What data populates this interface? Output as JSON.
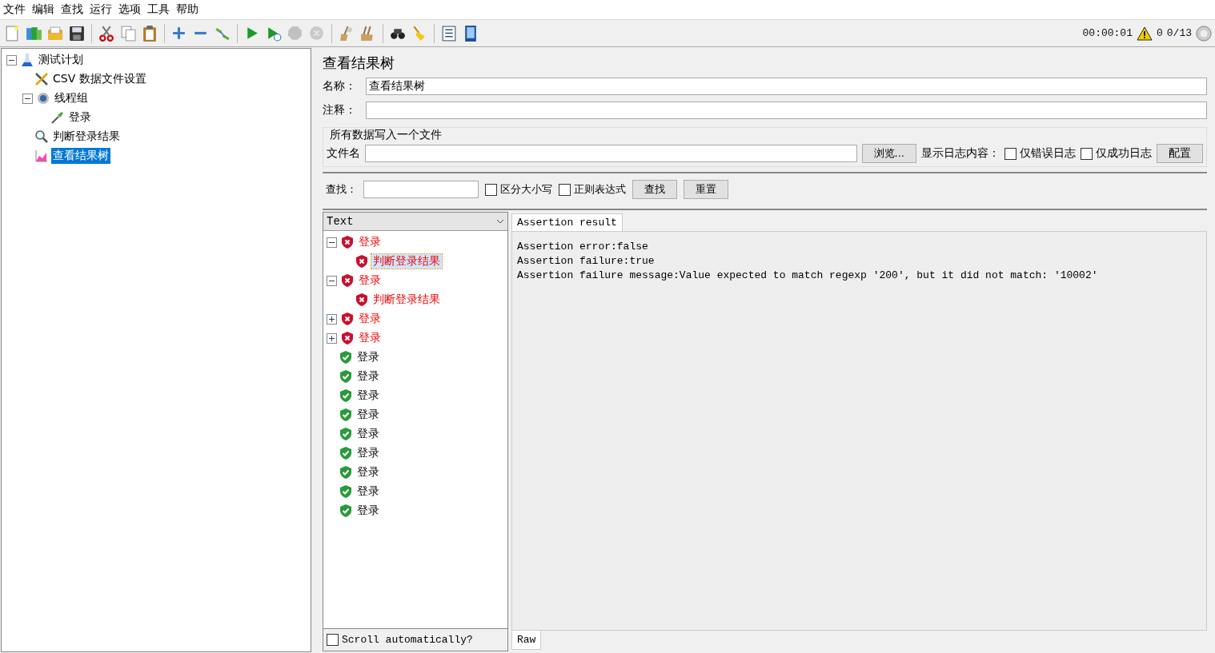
{
  "menu": [
    "文件",
    "编辑",
    "查找",
    "运行",
    "选项",
    "工具",
    "帮助"
  ],
  "toolbar": [
    [
      {
        "disabled": false
      },
      {
        "disabled": false
      },
      {
        "disabled": false
      },
      {
        "disabled": false
      }
    ],
    [
      {
        "disabled": false
      },
      {
        "disabled": false
      },
      {
        "disabled": false
      }
    ],
    [
      {
        "disabled": false
      },
      {
        "disabled": false
      },
      {
        "disabled": false
      }
    ],
    [
      {
        "disabled": false
      },
      {
        "disabled": false
      },
      {
        "disabled": true
      },
      {
        "disabled": true
      }
    ],
    [
      {
        "disabled": false
      },
      {
        "disabled": false
      }
    ],
    [
      {
        "disabled": false
      },
      {
        "disabled": false
      }
    ],
    [
      {
        "disabled": false
      },
      {
        "disabled": false
      }
    ]
  ],
  "status": {
    "timer": "00:00:01",
    "warnings": "0",
    "threads": "0/13"
  },
  "tree": [
    {
      "label": "测试计划",
      "kind": "plan",
      "expanded": true,
      "selected": false,
      "children": [
        {
          "label": "CSV 数据文件设置",
          "kind": "config",
          "selected": false
        },
        {
          "label": "线程组",
          "kind": "threads",
          "expanded": true,
          "selected": false,
          "children": [
            {
              "label": "登录",
              "kind": "sampler",
              "selected": false
            }
          ]
        },
        {
          "label": "判断登录结果",
          "kind": "assertion",
          "selected": false
        },
        {
          "label": "查看结果树",
          "kind": "listener",
          "selected": true
        }
      ]
    }
  ],
  "panel": {
    "title": "查看结果树",
    "name_label": "名称：",
    "name_value": "查看结果树",
    "comment_label": "注释：",
    "file_group": "所有数据写入一个文件",
    "file_label": "文件名",
    "browse": "浏览...",
    "log_label": "显示日志内容：",
    "checks": [
      {
        "label": "仅错误日志",
        "checked": false
      },
      {
        "label": "仅成功日志",
        "checked": false
      }
    ],
    "config": "配置",
    "search_label": "查找：",
    "search_checks": [
      {
        "label": "区分大小写",
        "checked": false
      },
      {
        "label": "正则表达式",
        "checked": false
      }
    ],
    "find": "查找",
    "reset": "重置"
  },
  "results": {
    "renderer": "Text",
    "items": [
      {
        "label": "登录",
        "passed": false,
        "expanded": true,
        "children": [
          {
            "label": "判断登录结果",
            "passed": false,
            "selected": true
          }
        ],
        "selected": false
      },
      {
        "label": "登录",
        "passed": false,
        "expanded": true,
        "children": [
          {
            "label": "判断登录结果",
            "passed": false,
            "selected": false
          }
        ],
        "selected": false
      },
      {
        "label": "登录",
        "passed": false,
        "expanded": false,
        "selected": false
      },
      {
        "label": "登录",
        "passed": false,
        "expanded": false,
        "selected": false
      },
      {
        "label": "登录",
        "passed": true,
        "selected": false
      },
      {
        "label": "登录",
        "passed": true,
        "selected": false
      },
      {
        "label": "登录",
        "passed": true,
        "selected": false
      },
      {
        "label": "登录",
        "passed": true,
        "selected": false
      },
      {
        "label": "登录",
        "passed": true,
        "selected": false
      },
      {
        "label": "登录",
        "passed": true,
        "selected": false
      },
      {
        "label": "登录",
        "passed": true,
        "selected": false
      },
      {
        "label": "登录",
        "passed": true,
        "selected": false
      },
      {
        "label": "登录",
        "passed": true,
        "selected": false
      }
    ],
    "scroll": {
      "label": "Scroll automatically?",
      "checked": false
    },
    "tab": "Assertion result",
    "lines": [
      "Assertion error:false",
      "Assertion failure:true",
      "Assertion failure message:Value expected to match regexp '200', but it did not match: '10002'"
    ],
    "bottom_tab": "Raw"
  }
}
